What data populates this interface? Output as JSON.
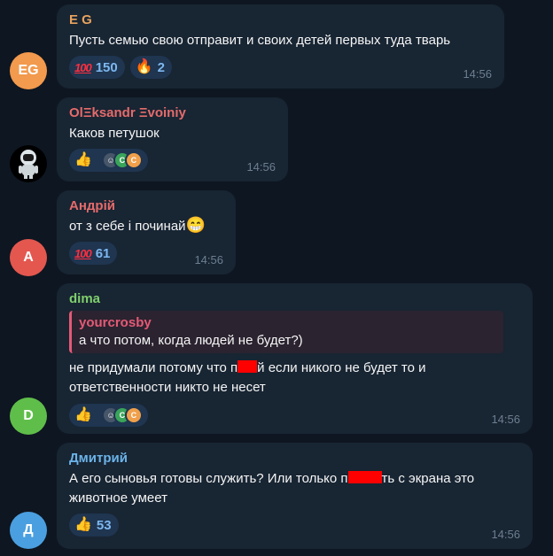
{
  "messages": [
    {
      "sender": "E G",
      "sender_color": "#e8a35e",
      "avatar_text": "EG",
      "avatar_color": "#f29a4d",
      "text": "Пусть семью свою отправит и своих детей первых туда тварь",
      "reactions": [
        {
          "icon": "hundred-points-icon",
          "count": "150"
        },
        {
          "icon": "fire-icon",
          "count": "2"
        }
      ],
      "time": "14:56"
    },
    {
      "sender": "OlΞksandr Ξvoiniy",
      "sender_color": "#e56b6b",
      "avatar_icon": "astronaut-avatar-icon",
      "text": "Каков петушок",
      "reactions": [
        {
          "icon": "thumbs-up-icon",
          "reactors": [
            "avatar",
            "C",
            "C"
          ]
        }
      ],
      "time": "14:56"
    },
    {
      "sender": "Андрій",
      "sender_color": "#e56b6b",
      "avatar_text": "A",
      "avatar_color": "#e4574f",
      "text": "от з себе і починай",
      "text_emoji": "grinning-face-icon",
      "reactions": [
        {
          "icon": "hundred-points-icon",
          "count": "61"
        }
      ],
      "time": "14:56"
    },
    {
      "sender": "dima",
      "sender_color": "#7fcf6c",
      "avatar_text": "D",
      "avatar_color": "#5fbe4a",
      "reply": {
        "name": "yourcrosby",
        "text": "а что потом, когда людей не будет?)"
      },
      "text_line1_a": "не придумали потому что п",
      "text_line1_b": "й если никого не будет то и",
      "text_line2": "ответственности никто не несет",
      "reactions": [
        {
          "icon": "thumbs-up-icon",
          "reactors": [
            "avatar",
            "C",
            "C"
          ]
        }
      ],
      "time": "14:56"
    },
    {
      "sender": "Дмитрий",
      "sender_color": "#6bb3e8",
      "avatar_text": "Д",
      "avatar_color": "#4a9fe0",
      "text_line1_a": "А его сыновья готовы служить? Или только п",
      "text_line1_b": "ть с экрана это",
      "text_line2": "животное умеет",
      "reactions": [
        {
          "icon": "thumbs-up-icon",
          "count": "53"
        }
      ],
      "time": "14:56"
    }
  ]
}
